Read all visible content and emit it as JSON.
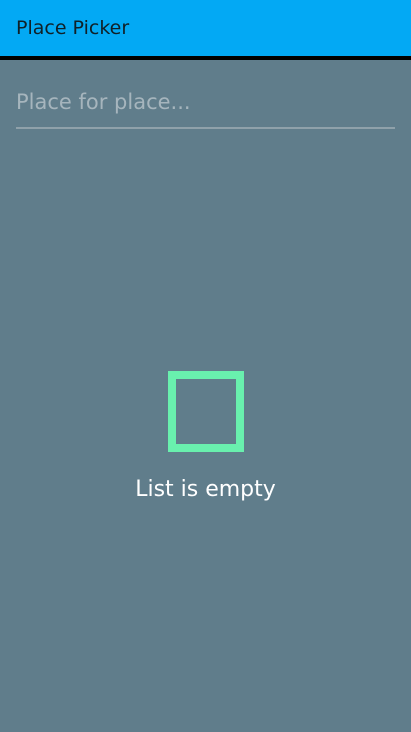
{
  "app": {
    "title": "Place Picker"
  },
  "search": {
    "value": "",
    "placeholder": "Place for place..."
  },
  "empty_state": {
    "icon": "empty-square-icon",
    "message": "List is empty"
  },
  "colors": {
    "appbar_background": "#03a9f4",
    "page_background": "#607d8b",
    "accent": "#69f0ae",
    "title_text": "#102027",
    "message_text": "#ffffff"
  }
}
